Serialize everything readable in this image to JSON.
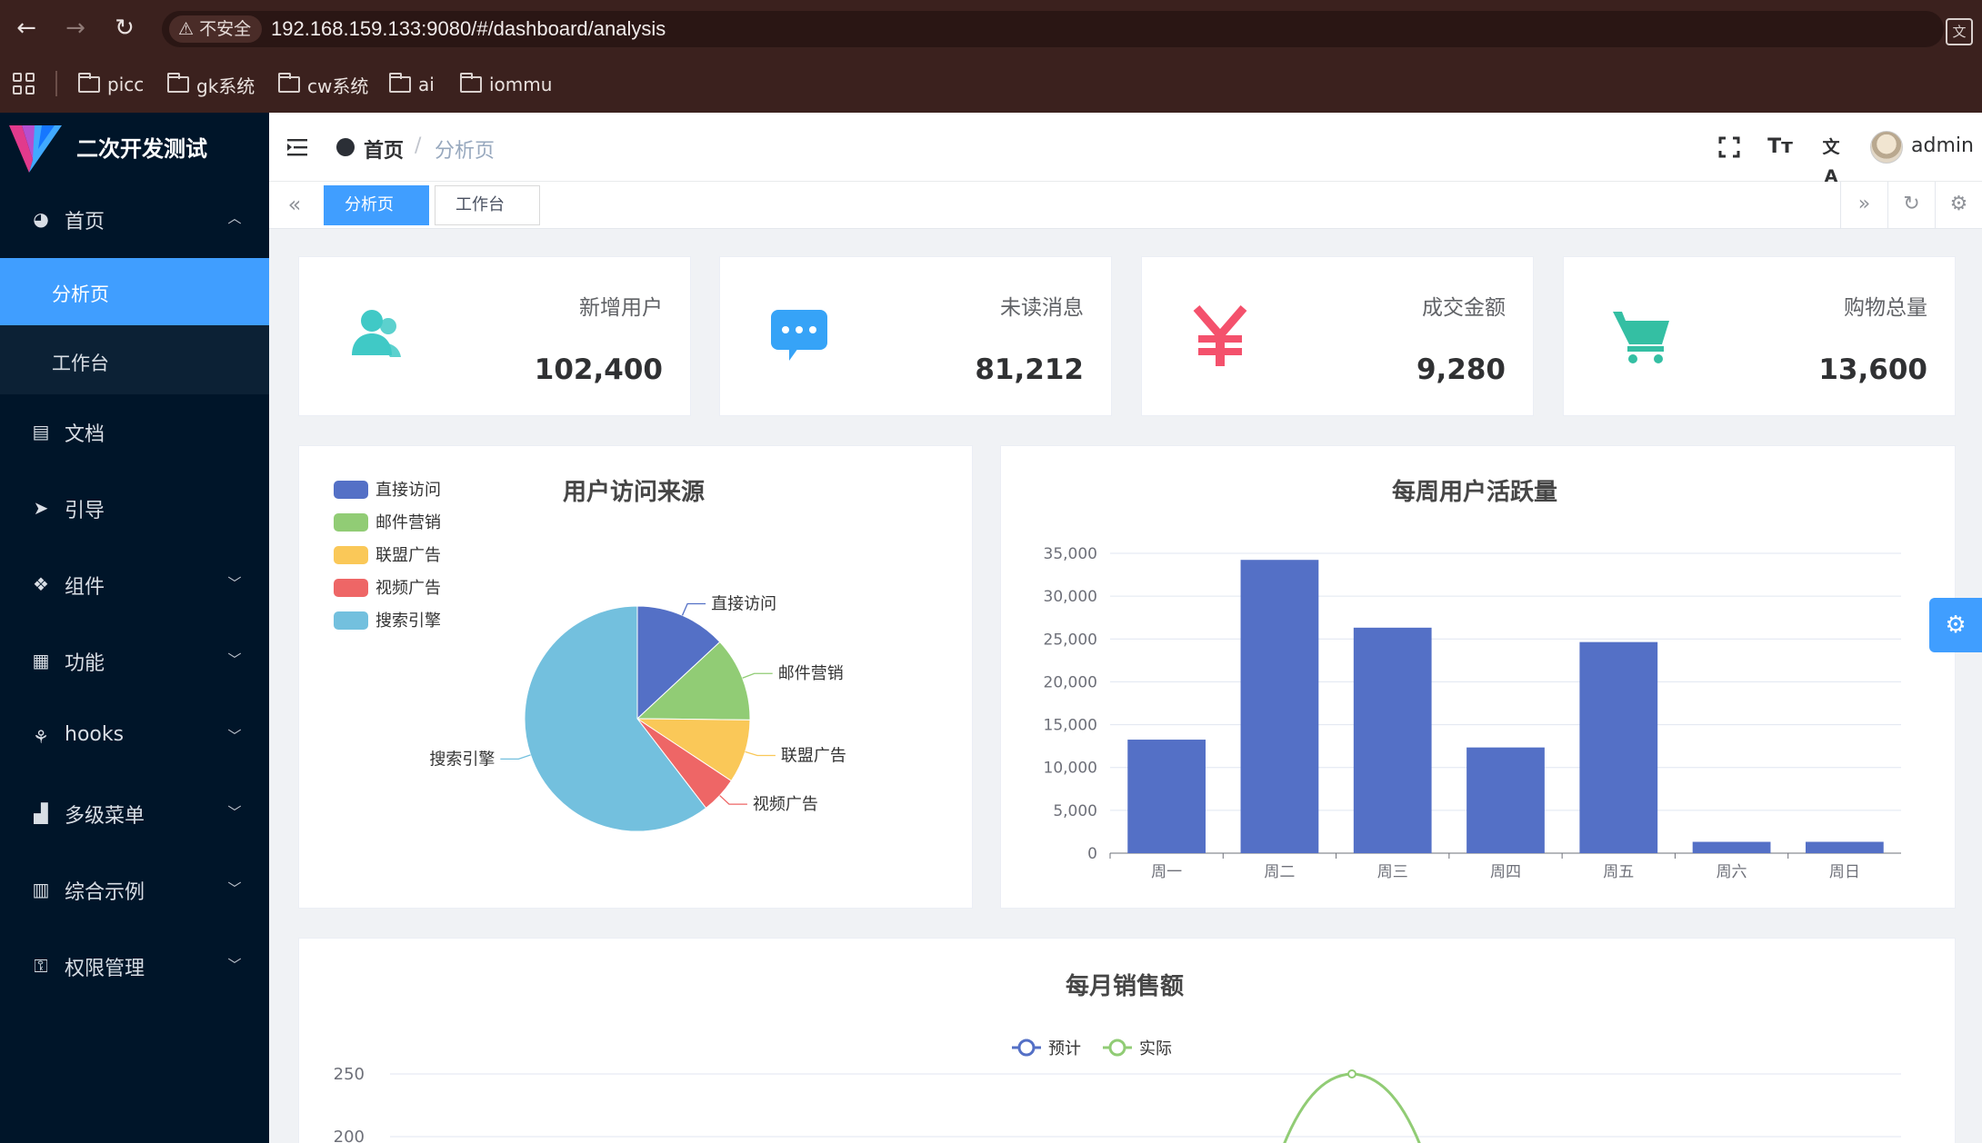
{
  "browser": {
    "security_label": "不安全",
    "url": "192.168.159.133:9080/#/dashboard/analysis",
    "bookmarks": [
      "picc",
      "gk系统",
      "cw系统",
      "ai",
      "iommu"
    ]
  },
  "sidebar": {
    "app_name": "二次开发测试",
    "items": [
      {
        "label": "首页",
        "icon": "dashboard-icon"
      },
      {
        "label": "文档",
        "icon": "document-icon"
      },
      {
        "label": "引导",
        "icon": "send-icon"
      },
      {
        "label": "组件",
        "icon": "components-icon"
      },
      {
        "label": "功能",
        "icon": "grid-icon"
      },
      {
        "label": "hooks",
        "icon": "hooks-icon"
      },
      {
        "label": "多级菜单",
        "icon": "chart-bars-icon"
      },
      {
        "label": "综合示例",
        "icon": "library-icon"
      },
      {
        "label": "权限管理",
        "icon": "permission-icon"
      }
    ],
    "sub_items": [
      {
        "label": "分析页",
        "active": true
      },
      {
        "label": "工作台",
        "active": false
      }
    ]
  },
  "header": {
    "breadcrumb_home": "首页",
    "breadcrumb_separator": "/",
    "breadcrumb_current": "分析页",
    "username": "admin",
    "font_size_icon_text": "Tт",
    "translate_icon_text": "文A"
  },
  "tags": [
    {
      "label": "分析页",
      "active": true
    },
    {
      "label": "工作台",
      "active": false
    }
  ],
  "stats": [
    {
      "title": "新增用户",
      "value": "102,400",
      "icon": "users-icon",
      "color": "#40c9c6"
    },
    {
      "title": "未读消息",
      "value": "81,212",
      "icon": "message-icon",
      "color": "#36a3f7"
    },
    {
      "title": "成交金额",
      "value": "9,280",
      "icon": "money-icon",
      "color": "#f4516c"
    },
    {
      "title": "购物总量",
      "value": "13,600",
      "icon": "shopping-icon",
      "color": "#34bfa3"
    }
  ],
  "chart_data": [
    {
      "type": "pie",
      "title": "用户访问来源",
      "categories": [
        "直接访问",
        "邮件营销",
        "联盟广告",
        "视频广告",
        "搜索引擎"
      ],
      "values": [
        335,
        310,
        234,
        135,
        1548
      ],
      "colors": [
        "#5470c6",
        "#91cc75",
        "#fac858",
        "#ee6666",
        "#73c0de"
      ],
      "legend": "top-left"
    },
    {
      "type": "bar",
      "title": "每周用户活跃量",
      "categories": [
        "周一",
        "周二",
        "周三",
        "周四",
        "周五",
        "周六",
        "周日"
      ],
      "values": [
        13253,
        34235,
        26321,
        12340,
        24643,
        1322,
        1324
      ],
      "ylim": [
        0,
        35000
      ],
      "yticks": [
        "35,000",
        "30,000",
        "25,000",
        "20,000",
        "15,000",
        "10,000",
        "5,000",
        "0"
      ],
      "color": "#5470c6",
      "grid": true
    },
    {
      "type": "line",
      "title": "每月销售额",
      "series": [
        {
          "name": "预计",
          "color": "#5470c6"
        },
        {
          "name": "实际",
          "color": "#91cc75",
          "peak": 250
        }
      ],
      "yticks": [
        "250",
        "200"
      ],
      "legend": "top-center"
    }
  ]
}
